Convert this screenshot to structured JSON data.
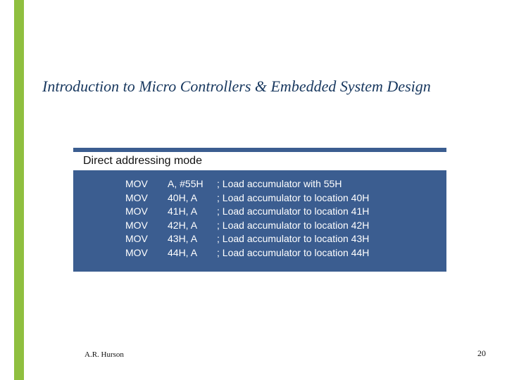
{
  "title": "Introduction to Micro Controllers & Embedded System Design",
  "box": {
    "header": "Direct addressing mode",
    "rows": [
      {
        "op": "MOV",
        "args": "A, #55H",
        "comment": "; Load accumulator with 55H"
      },
      {
        "op": "MOV",
        "args": "40H, A",
        "comment": "; Load accumulator to location 40H"
      },
      {
        "op": "MOV",
        "args": "41H, A",
        "comment": "; Load accumulator to location 41H"
      },
      {
        "op": "MOV",
        "args": "42H, A",
        "comment": "; Load accumulator to location 42H"
      },
      {
        "op": "MOV",
        "args": "43H, A",
        "comment": "; Load accumulator to location 43H"
      },
      {
        "op": "MOV",
        "args": "44H, A",
        "comment": "; Load accumulator to location 44H"
      }
    ]
  },
  "footer": {
    "author": "A.R. Hurson",
    "page": "20"
  }
}
